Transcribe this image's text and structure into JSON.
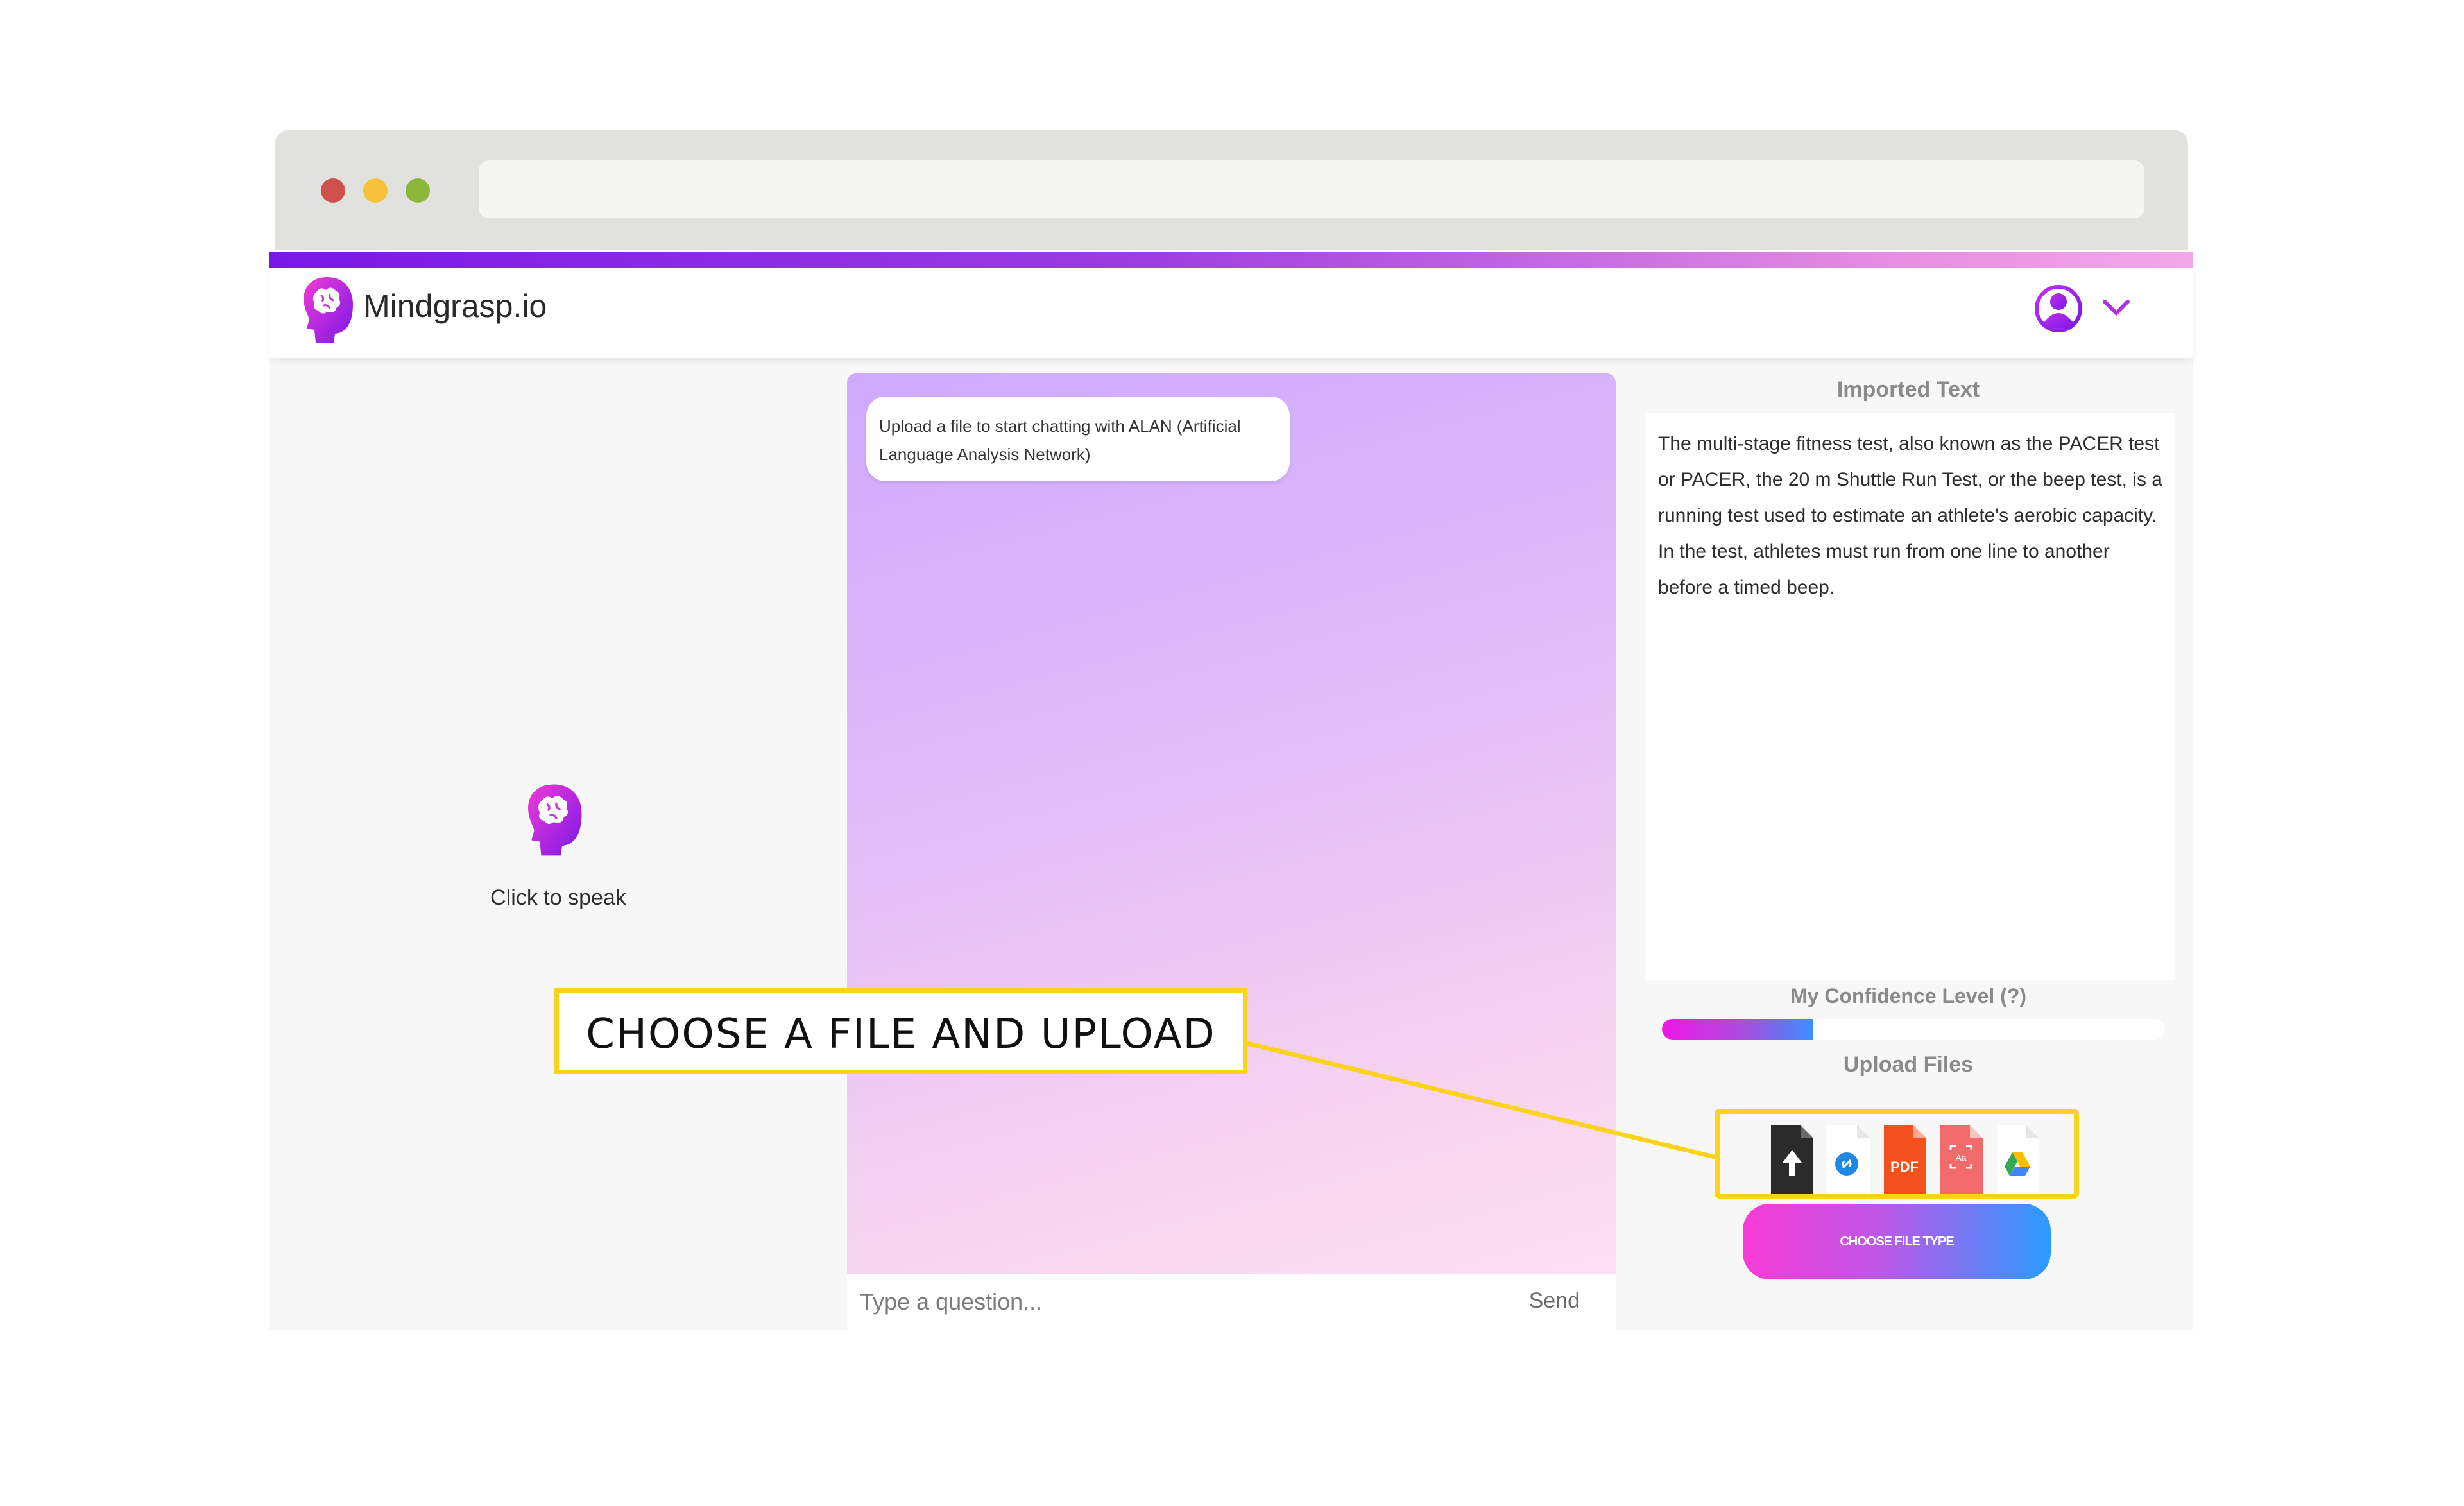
{
  "app": {
    "title": "Mindgrasp.io"
  },
  "speak": {
    "label": "Click to speak"
  },
  "chat": {
    "bubble_text": "Upload a file to start chatting with ALAN (Artificial Language Analysis Network)",
    "input_placeholder": "Type a question...",
    "send_label": "Send"
  },
  "imported": {
    "title": "Imported Text",
    "text": "The multi-stage fitness test, also known as the PACER test or PACER, the 20 m Shuttle Run Test, or the beep test, is a running test used to estimate an athlete's aerobic capacity. In the test, athletes must run from one line to another before a timed beep."
  },
  "confidence": {
    "label": "My Confidence Level (?)",
    "level": 0.3
  },
  "upload": {
    "label": "Upload Files",
    "icons": [
      "upload-file-icon",
      "link-icon",
      "pdf-icon",
      "scan-icon",
      "google-drive-icon"
    ],
    "choose_button": "CHOOSE FILE TYPE"
  },
  "callout": {
    "text": "CHOOSE A FILE AND UPLOAD"
  },
  "colors": {
    "brand_purple": "#7a18e6",
    "brand_pink": "#f83bd6",
    "brand_blue": "#2a9bff",
    "highlight_yellow": "#fbd21c"
  }
}
